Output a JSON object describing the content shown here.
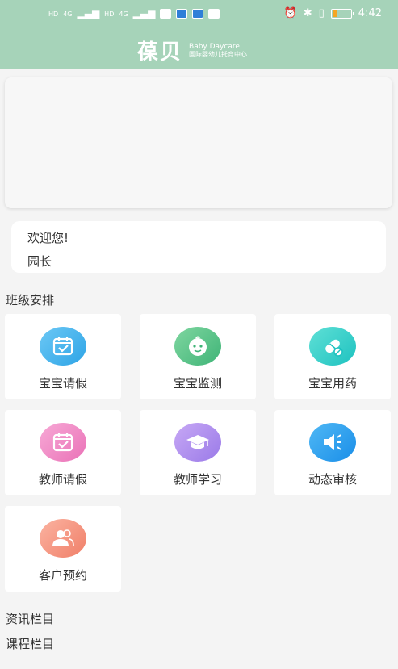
{
  "status_bar": {
    "sim1": "HD",
    "sim2": "HD",
    "network1": "4G",
    "network2": "4G",
    "time": "4:42",
    "battery_level_percent": 20
  },
  "brand": {
    "logo": "葆贝",
    "en": "Baby Daycare",
    "cn": "国际婴幼儿托育中心"
  },
  "welcome": {
    "greeting": "欢迎您!",
    "role": "园长"
  },
  "sections": {
    "class_arrangement": "班级安排",
    "news": "资讯栏目",
    "courses": "课程栏目"
  },
  "tiles": [
    {
      "label": "宝宝请假",
      "icon": "calendar-check-icon",
      "color": "#2ea4e6"
    },
    {
      "label": "宝宝监测",
      "icon": "baby-face-icon",
      "color": "#3fb477"
    },
    {
      "label": "宝宝用药",
      "icon": "pill-icon",
      "color": "#1ec2c0"
    },
    {
      "label": "教师请假",
      "icon": "calendar-check-icon",
      "color": "#ea72b7"
    },
    {
      "label": "教师学习",
      "icon": "graduation-cap-icon",
      "color": "#9a7ae8"
    },
    {
      "label": "动态审核",
      "icon": "speaker-icon",
      "color": "#1a8ee8"
    },
    {
      "label": "客户预约",
      "icon": "users-icon",
      "color": "#f07f68"
    }
  ],
  "colors": {
    "header": "#a6d3b9",
    "background": "#f4f4f4"
  }
}
